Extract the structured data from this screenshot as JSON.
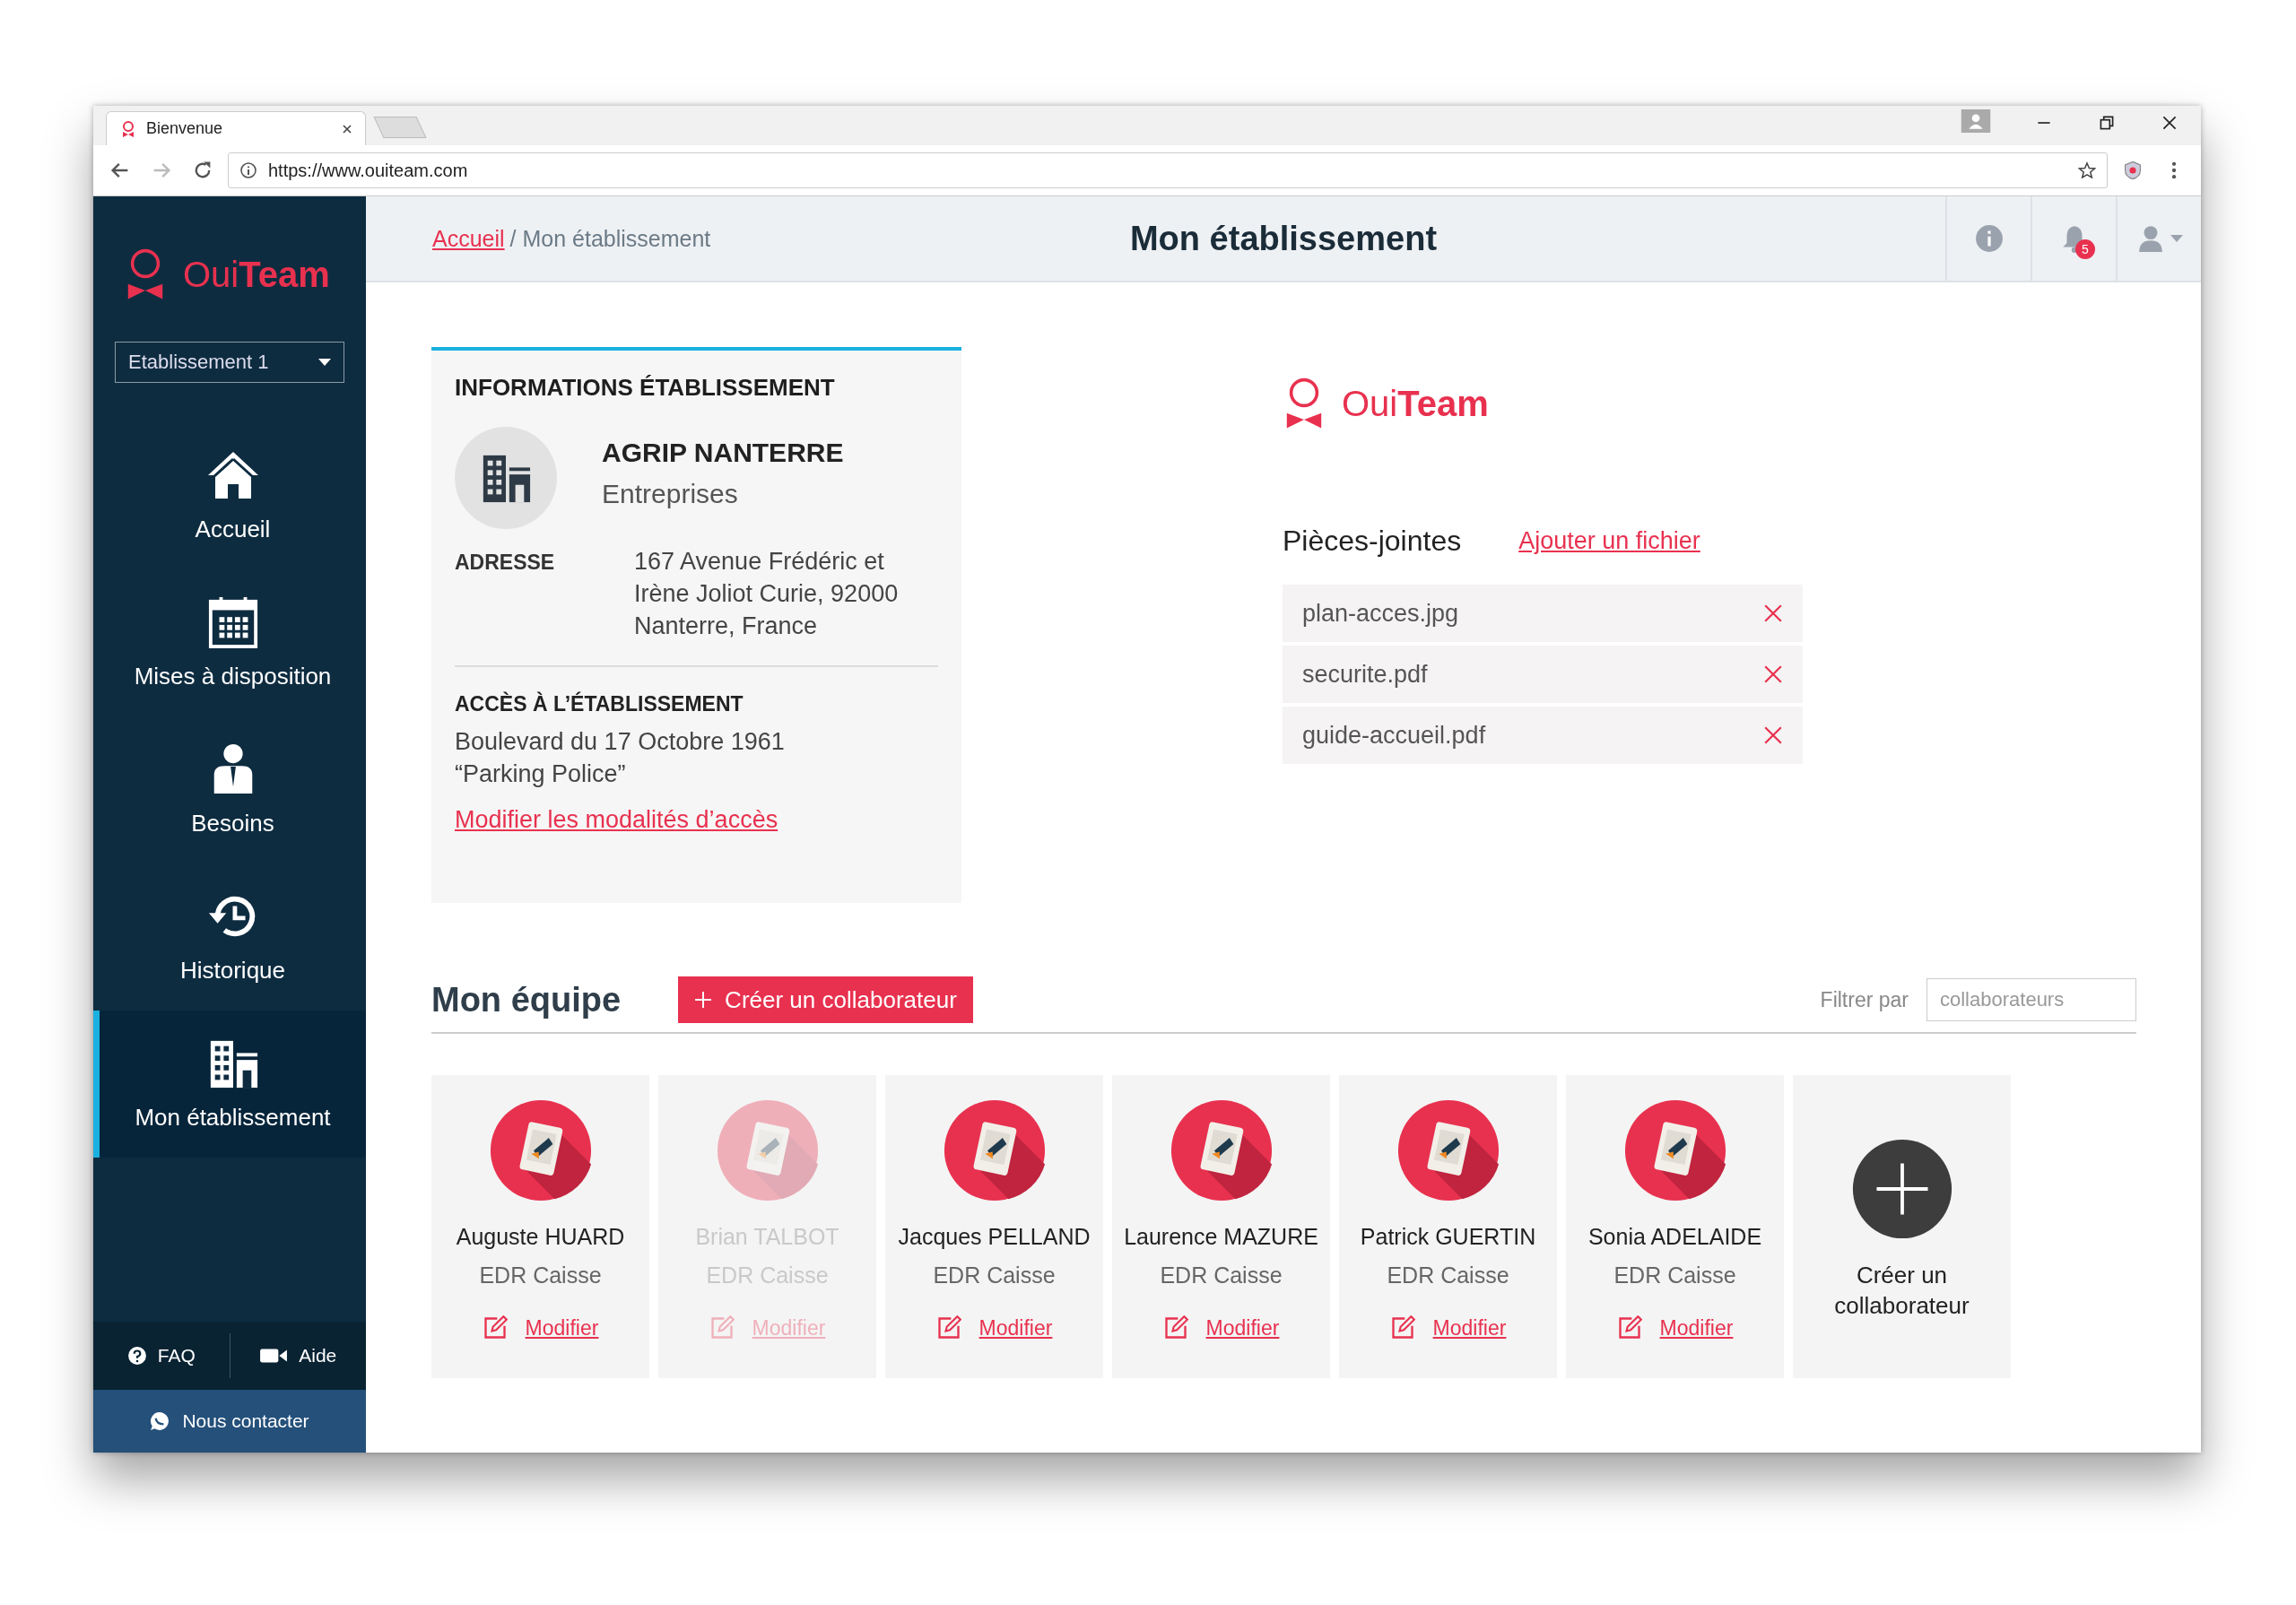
{
  "browser": {
    "tab_title": "Bienvenue",
    "url": "https://www.ouiteam.com"
  },
  "sidebar": {
    "logo": "Oui**Team**",
    "establishment_select": "Etablissement 1",
    "items": [
      {
        "label": "Accueil",
        "selected": false
      },
      {
        "label": "Mises à disposition",
        "selected": false
      },
      {
        "label": "Besoins",
        "selected": false
      },
      {
        "label": "Historique",
        "selected": false
      },
      {
        "label": "Mon établissement",
        "selected": true
      }
    ],
    "footer_links": [
      "FAQ",
      "Aide"
    ],
    "contact": "Nous contacter"
  },
  "header": {
    "breadcrumb_link": "Accueil",
    "breadcrumb_current": "/ Mon établissement",
    "title": "Mon établissement",
    "notification_count": "5"
  },
  "info_card": {
    "title": "INFORMATIONS ÉTABLISSEMENT",
    "name": "AGRIP NANTERRE",
    "type": "Entreprises",
    "address_label": "ADRESSE",
    "address": "167 Avenue Frédéric et Irène Joliot Curie, 92000 Nanterre, France",
    "access_title": "ACCÈS À L’ÉTABLISSEMENT",
    "access_lines": [
      "Boulevard du 17 Octobre 1961",
      "“Parking Police”"
    ],
    "access_link": "Modifier les modalités d’accès"
  },
  "attachments": {
    "logo": "Oui**Team**",
    "title": "Pièces-jointes",
    "add_link": "Ajouter un fichier",
    "files": [
      "plan-acces.jpg",
      "securite.pdf",
      "guide-accueil.pdf"
    ]
  },
  "team": {
    "title": "Mon équipe",
    "create_button": "Créer un collaborateur",
    "filter_label": "Filtrer par",
    "filter_placeholder": "collaborateurs",
    "members": [
      {
        "name": "Auguste HUARD",
        "role": "EDR Caisse",
        "action": "Modifier",
        "disabled": false
      },
      {
        "name": "Brian TALBOT",
        "role": "EDR Caisse",
        "action": "Modifier",
        "disabled": true
      },
      {
        "name": "Jacques PELLAND",
        "role": "EDR Caisse",
        "action": "Modifier",
        "disabled": false
      },
      {
        "name": "Laurence MAZURE",
        "role": "EDR Caisse",
        "action": "Modifier",
        "disabled": false
      },
      {
        "name": "Patrick GUERTIN",
        "role": "EDR Caisse",
        "action": "Modifier",
        "disabled": false
      },
      {
        "name": "Sonia ADELAIDE",
        "role": "EDR Caisse",
        "action": "Modifier",
        "disabled": false
      }
    ],
    "add_card_label": "Créer un collaborateur"
  }
}
